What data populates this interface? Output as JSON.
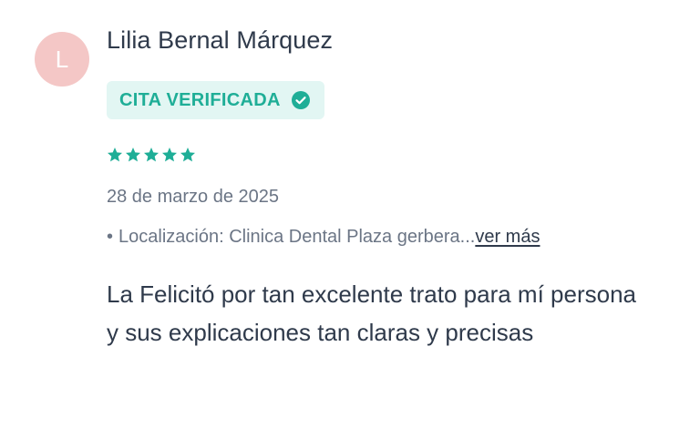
{
  "review": {
    "avatar_initial": "L",
    "author": "Lilia Bernal Márquez",
    "badge_label": "CITA VERIFICADA",
    "rating": 5,
    "rating_max": 5,
    "date": "28 de marzo de 2025",
    "location_bullet": "•",
    "location_text": "Localización: Clinica Dental Plaza gerbera...",
    "more_link": "ver más",
    "body": "La Felicitó por tan excelente trato para mí persona y sus explicaciones tan claras y precisas"
  },
  "colors": {
    "accent": "#1fae97",
    "badge_bg": "#e2f6f3",
    "avatar_bg": "#f4c7c6",
    "text_primary": "#2f3a4b",
    "text_secondary": "#6b7585"
  },
  "icons": {
    "badge": "check-circle-icon",
    "rating": "star-icon"
  }
}
